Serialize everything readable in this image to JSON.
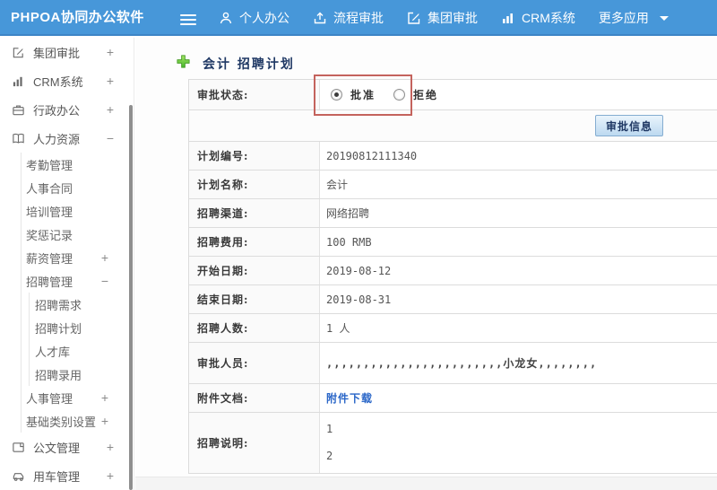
{
  "header": {
    "logo": "PHPOA协同办公软件",
    "nav": [
      {
        "label": "个人办公",
        "icon": "user-icon"
      },
      {
        "label": "流程审批",
        "icon": "upload-icon"
      },
      {
        "label": "集团审批",
        "icon": "edit-icon"
      },
      {
        "label": "CRM系统",
        "icon": "bar-chart-icon"
      },
      {
        "label": "更多应用",
        "icon": "caret-down-icon"
      }
    ]
  },
  "sidebar": {
    "items": [
      {
        "label": "集团审批",
        "icon": "edit-icon",
        "expander": "+"
      },
      {
        "label": "CRM系统",
        "icon": "bar-chart-icon",
        "expander": "+"
      },
      {
        "label": "行政办公",
        "icon": "briefcase-icon",
        "expander": "+"
      },
      {
        "label": "人力资源",
        "icon": "book-icon",
        "expander": "−"
      },
      {
        "label": "考勤管理"
      },
      {
        "label": "人事合同"
      },
      {
        "label": "培训管理"
      },
      {
        "label": "奖惩记录"
      },
      {
        "label": "薪资管理",
        "expander": "+"
      },
      {
        "label": "招聘管理",
        "expander": "−"
      },
      {
        "label": "招聘需求"
      },
      {
        "label": "招聘计划"
      },
      {
        "label": "人才库"
      },
      {
        "label": "招聘录用"
      },
      {
        "label": "人事管理",
        "expander": "+"
      },
      {
        "label": "基础类别设置",
        "expander": "+"
      },
      {
        "label": "公文管理",
        "icon": "document-icon",
        "expander": "+"
      },
      {
        "label": "用车管理",
        "icon": "car-icon",
        "expander": "+"
      }
    ]
  },
  "main": {
    "title": "会计 招聘计划",
    "form": {
      "status_label": "审批状态:",
      "radio_approve": "批准",
      "radio_reject": "拒绝",
      "approve_selected": true,
      "info_button": "审批信息",
      "rows": [
        {
          "label": "计划编号:",
          "value": "20190812111340"
        },
        {
          "label": "计划名称:",
          "value": "会计"
        },
        {
          "label": "招聘渠道:",
          "value": "网络招聘"
        },
        {
          "label": "招聘费用:",
          "value": "100 RMB"
        },
        {
          "label": "开始日期:",
          "value": "2019-08-12"
        },
        {
          "label": "结束日期:",
          "value": "2019-08-31"
        },
        {
          "label": "招聘人数:",
          "value": "1 人"
        }
      ],
      "approver_label": "审批人员:",
      "approver_value": ",,,,,,,,,,,,,,,,,,,,,,,,小龙女,,,,,,,,",
      "attachment_label": "附件文档:",
      "attachment_link": "附件下载",
      "desc_label": "招聘说明:",
      "desc_line1": "1",
      "desc_line2": "2"
    }
  },
  "colors": {
    "header_blue": "#4797d9",
    "header_border": "#3d85c6",
    "title_navy": "#1f3864",
    "link_blue": "#2a66c8",
    "annotation_red": "#c4635d",
    "button_border": "#85add1",
    "plus_green": "#43b52b",
    "table_border": "#dcdcdc"
  }
}
